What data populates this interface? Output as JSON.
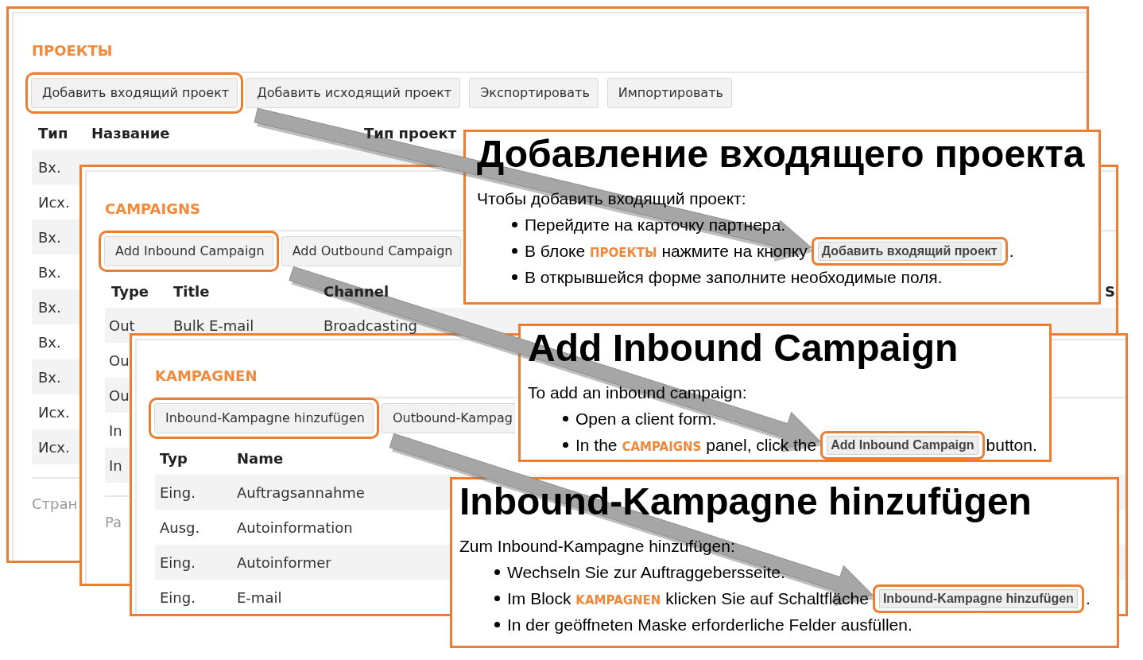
{
  "panels": [
    {
      "title": "ПРОЕКТЫ",
      "buttons": [
        {
          "label": "Добавить входящий проект",
          "highlighted": true
        },
        {
          "label": "Добавить исходящий проект",
          "highlighted": false
        },
        {
          "label": "Экспортировать",
          "highlighted": false
        },
        {
          "label": "Импортировать",
          "highlighted": false
        }
      ],
      "table": {
        "columns": [
          "Тип",
          "Название",
          "Тип проект"
        ],
        "rows": [
          [
            "Вх."
          ],
          [
            "Исх."
          ],
          [
            "Вх."
          ],
          [
            "Вх."
          ],
          [
            "Вх."
          ],
          [
            "Вх."
          ],
          [
            "Вх."
          ],
          [
            "Исх."
          ],
          [
            "Исх."
          ]
        ]
      },
      "pager": "Стран"
    },
    {
      "title": "CAMPAIGNS",
      "buttons": [
        {
          "label": "Add Inbound Campaign",
          "highlighted": true
        },
        {
          "label": "Add Outbound Campaign",
          "highlighted": false
        }
      ],
      "table": {
        "columns": [
          "Type",
          "Title",
          "Channel",
          "S"
        ],
        "rows": [
          [
            "Out",
            "Bulk E-mail",
            "Broadcasting"
          ],
          [
            "Ou"
          ],
          [
            "Ou"
          ],
          [
            "In"
          ],
          [
            "In"
          ]
        ]
      },
      "pager": "Pa"
    },
    {
      "title": "KAMPAGNEN",
      "buttons": [
        {
          "label": "Inbound-Kampagne hinzufügen",
          "highlighted": true
        },
        {
          "label": "Outbound-Kampag",
          "highlighted": false
        }
      ],
      "table": {
        "columns": [
          "Typ",
          "Name"
        ],
        "rows": [
          [
            "Eing.",
            "Auftragsannahme"
          ],
          [
            "Ausg.",
            "Autoinformation"
          ],
          [
            "Eing.",
            "Autoinformer"
          ],
          [
            "Eing.",
            "E-mail"
          ]
        ]
      }
    }
  ],
  "help_cards": [
    {
      "heading": "Добавление входящего проекта",
      "intro": "Чтобы добавить входящий проект:",
      "steps": [
        {
          "text": "Перейдите на карточку партнера."
        },
        {
          "text": "В блоке **ПРОЕКТЫ** нажмите на кнопку",
          "button": {
            "label": "Добавить входящий проект",
            "highlighted": true
          },
          "after": "."
        },
        {
          "text": "В открывшейся форме заполните необходимые поля."
        }
      ]
    },
    {
      "heading": "Add Inbound Campaign",
      "intro": "To add an inbound campaign:",
      "steps": [
        {
          "text": "Open a client form."
        },
        {
          "text": "In the **CAMPAIGNS** panel, click the",
          "button": {
            "label": "Add Inbound Campaign",
            "highlighted": true
          },
          "after": "button."
        }
      ]
    },
    {
      "heading": "Inbound-Kampagne hinzufügen",
      "intro": "Zum Inbound-Kampagne hinzufügen:",
      "steps": [
        {
          "text": "Wechseln Sie zur Auftraggebersseite."
        },
        {
          "text": "Im Block **KAMPAGNEN** klicken Sie auf Schaltfläche",
          "button": {
            "label": "Inbound-Kampagne hinzufügen",
            "highlighted": true
          },
          "after": "."
        },
        {
          "text": "In der geöffneten Maske erforderliche Felder ausfüllen."
        }
      ]
    }
  ]
}
